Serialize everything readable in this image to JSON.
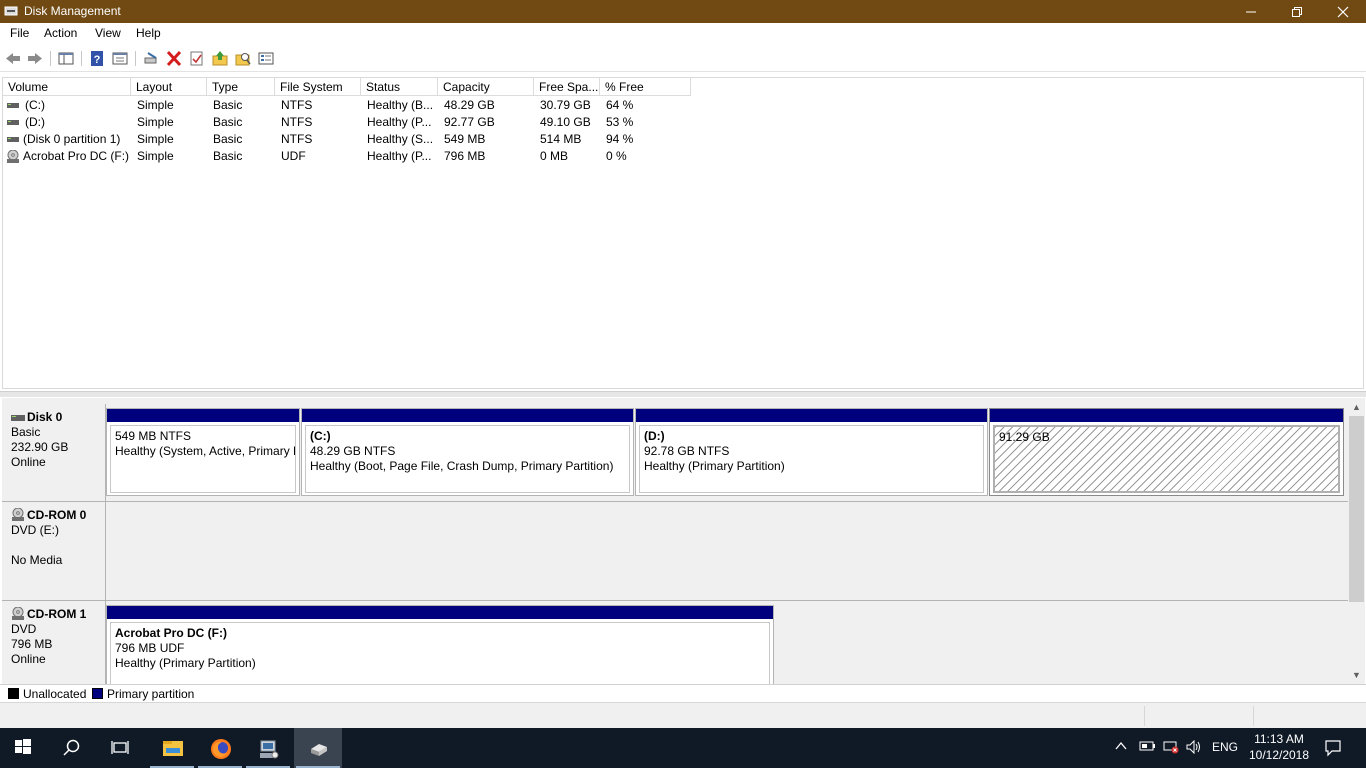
{
  "window": {
    "title": "Disk Management"
  },
  "menu": [
    "File",
    "Action",
    "View",
    "Help"
  ],
  "toolbar_icons": [
    "back-icon",
    "forward-icon",
    "show-hide-console-tree-icon",
    "help-icon",
    "properties-icon",
    "connect-icon",
    "delete-icon",
    "check-icon",
    "open-icon",
    "explore-icon",
    "settings-icon"
  ],
  "volume_table": {
    "headers": [
      "Volume",
      "Layout",
      "Type",
      "File System",
      "Status",
      "Capacity",
      "Free Spa...",
      "% Free"
    ],
    "rows": [
      {
        "icon": "drive-icon",
        "volume": "(C:)",
        "layout": "Simple",
        "type": "Basic",
        "fs": "NTFS",
        "status": "Healthy (B...",
        "capacity": "48.29 GB",
        "free": "30.79 GB",
        "pct": "64 %"
      },
      {
        "icon": "drive-icon",
        "volume": "(D:)",
        "layout": "Simple",
        "type": "Basic",
        "fs": "NTFS",
        "status": "Healthy (P...",
        "capacity": "92.77 GB",
        "free": "49.10 GB",
        "pct": "53 %"
      },
      {
        "icon": "drive-icon",
        "volume": "(Disk 0 partition 1)",
        "layout": "Simple",
        "type": "Basic",
        "fs": "NTFS",
        "status": "Healthy (S...",
        "capacity": "549 MB",
        "free": "514 MB",
        "pct": "94 %"
      },
      {
        "icon": "cd-icon",
        "volume": "Acrobat Pro DC (F:)",
        "layout": "Simple",
        "type": "Basic",
        "fs": "UDF",
        "status": "Healthy (P...",
        "capacity": "796 MB",
        "free": "0 MB",
        "pct": "0 %"
      }
    ]
  },
  "disks": [
    {
      "name": "Disk 0",
      "line1": "Basic",
      "line2": "232.90 GB",
      "line3": "Online",
      "partitions": [
        {
          "name": "",
          "size": "549 MB NTFS",
          "status": "Healthy (System, Active, Primary P"
        },
        {
          "name": "(C:)",
          "size": "48.29 GB NTFS",
          "status": "Healthy (Boot, Page File, Crash Dump, Primary Partition)"
        },
        {
          "name": "(D:)",
          "size": "92.78 GB NTFS",
          "status": "Healthy (Primary Partition)"
        },
        {
          "name": "",
          "size": "91.29 GB",
          "status": ""
        }
      ]
    },
    {
      "name": "CD-ROM 0",
      "line1": "DVD (E:)",
      "line2": "",
      "line3": "No Media",
      "partitions": []
    },
    {
      "name": "CD-ROM 1",
      "line1": "DVD",
      "line2": "796 MB",
      "line3": "Online",
      "partitions": [
        {
          "name": "Acrobat Pro DC  (F:)",
          "size": "796 MB UDF",
          "status": "Healthy (Primary Partition)"
        }
      ]
    }
  ],
  "legend": [
    {
      "label": "Unallocated",
      "color": "#000000"
    },
    {
      "label": "Primary partition",
      "color": "#00007f"
    }
  ],
  "taskbar": {
    "apps": [
      "start-icon",
      "search-icon",
      "task-view-icon",
      "file-explorer-icon",
      "firefox-icon",
      "computer-management-icon",
      "disk-management-icon"
    ],
    "language": "ENG",
    "time": "11:13 AM",
    "date": "10/12/2018"
  },
  "colors": {
    "titlebar": "#704a12",
    "primary_partition": "#00007f",
    "taskbar": "#101a26"
  }
}
